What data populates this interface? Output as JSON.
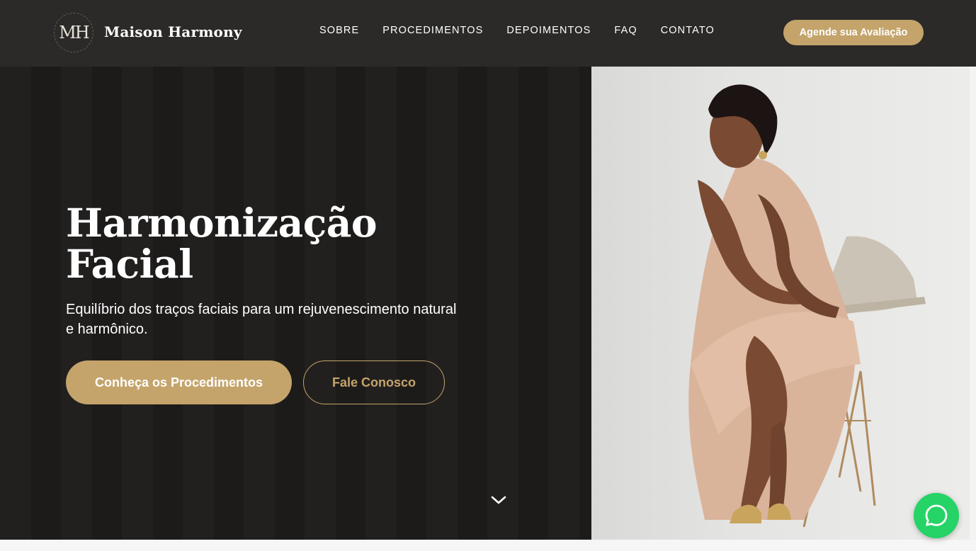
{
  "brand": {
    "name": "Maison Harmony",
    "monogram": "MH",
    "accent_color": "#c4a46b",
    "dark_bg": "#2b2a29"
  },
  "nav": {
    "items": [
      {
        "label": "SOBRE"
      },
      {
        "label": "PROCEDIMENTOS"
      },
      {
        "label": "DEPOIMENTOS"
      },
      {
        "label": "FAQ"
      },
      {
        "label": "CONTATO"
      }
    ],
    "cta_label": "Agende sua Avaliação"
  },
  "hero": {
    "title_line1": "Harmonização",
    "title_line2": "Facial",
    "subtitle": "Equilíbrio dos traços faciais para um rejuvenescimento natural e harmônico.",
    "primary_button": "Conheça os Procedimentos",
    "secondary_button": "Fale Conosco",
    "scroll_icon": "chevron-down-icon"
  },
  "photo": {
    "icon": "woman-portrait-photo"
  },
  "floating": {
    "whatsapp_icon": "whatsapp-icon",
    "whatsapp_color": "#25d366"
  }
}
